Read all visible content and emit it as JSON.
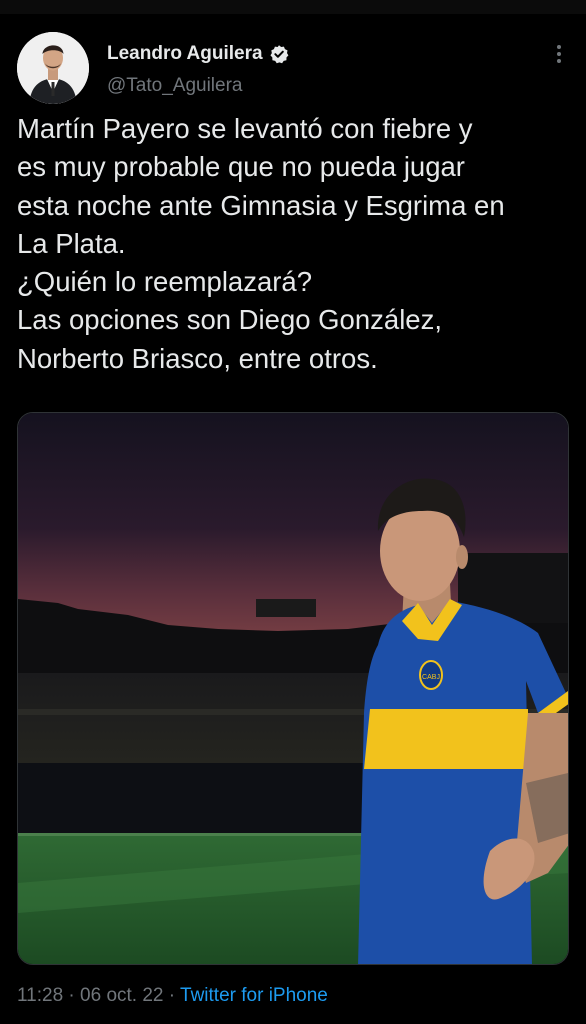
{
  "tweet": {
    "author": {
      "display_name": "Leandro Aguilera",
      "handle": "@Tato_Aguilera",
      "verified": true
    },
    "text_lines": [
      "Martín Payero se levantó con fiebre y",
      "es muy probable que no pueda jugar",
      "esta noche ante Gimnasia y Esgrima en",
      "La Plata.",
      "¿Quién lo reemplazará?",
      "Las opciones son Diego González,",
      "Norberto Briasco, entre otros."
    ],
    "media": {
      "jersey_badge": "CABJ"
    },
    "meta": {
      "time": "11:28",
      "separator": " · ",
      "date": "06 oct. 22",
      "source": "Twitter for iPhone"
    }
  },
  "colors": {
    "background": "#000000",
    "text": "#e7e9ea",
    "secondary_text": "#71767b",
    "link": "#1d9bf0",
    "jersey_blue": "#1d4fa8",
    "jersey_yellow": "#f2c21c"
  },
  "icons": {
    "verified": "verified-badge-icon",
    "more": "more-options-icon"
  }
}
